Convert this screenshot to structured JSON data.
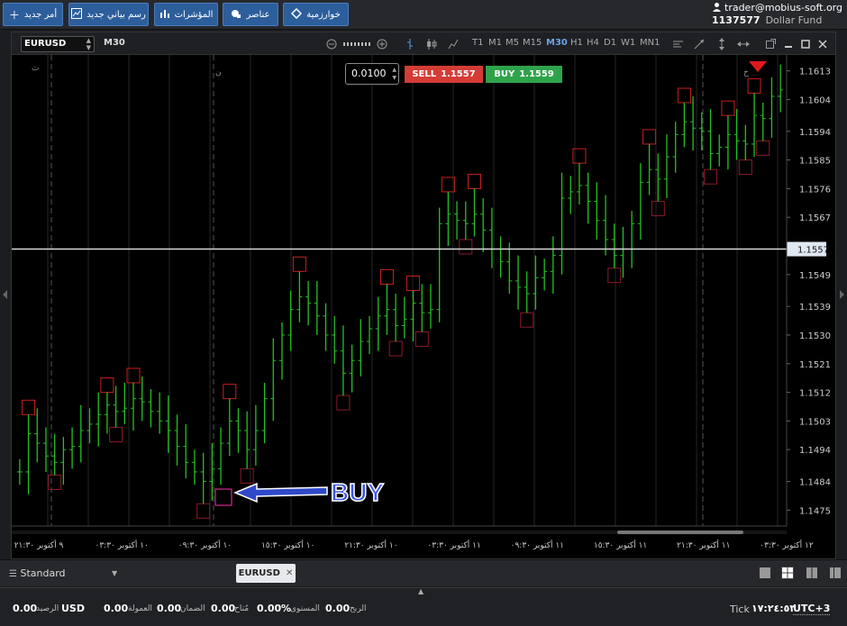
{
  "topbar": {
    "buttons": [
      {
        "label": "أمر جديد",
        "icon": "plus-icon"
      },
      {
        "label": "رسم بياني جديد",
        "icon": "chart-icon"
      },
      {
        "label": "المؤشرات",
        "icon": "bars-icon"
      },
      {
        "label": "عناصر",
        "icon": "shapes-icon"
      },
      {
        "label": "خوارزمية",
        "icon": "diamond-icon"
      }
    ],
    "account_email": "trader@mobius-soft.org",
    "account_number": "1137577",
    "account_fund": "Dollar Fund"
  },
  "chart_window": {
    "symbol": "EURUSD",
    "timeframe": "M30",
    "timeframes": [
      "T1",
      "M1",
      "M5",
      "M15",
      "M30",
      "H1",
      "H4",
      "D1",
      "W1",
      "MN1"
    ],
    "active_timeframe": "M30",
    "lot_value": "0.0100",
    "sell_label": "SELL",
    "sell_price": "1.1557",
    "buy_label": "BUY",
    "buy_price": "1.1559",
    "annotation": "BUY",
    "session_marks": [
      "ث",
      "ن",
      "خ"
    ]
  },
  "chart_data": {
    "type": "ohlc",
    "symbol": "EURUSD",
    "timeframe": "M30",
    "current_price": 1.1557,
    "ylim": [
      1.147,
      1.1618
    ],
    "y_ticks": [
      "1.1613",
      "1.1604",
      "1.1594",
      "1.1585",
      "1.1576",
      "1.1567",
      "1.1557",
      "1.1549",
      "1.1539",
      "1.1530",
      "1.1521",
      "1.1512",
      "1.1503",
      "1.1494",
      "1.1484",
      "1.1475"
    ],
    "x_ticks": [
      "٩ أكتوبر ٢١:٣٠",
      "١٠ أكتوبر ٠٣:٣٠",
      "١٠ أكتوبر ٠٩:٣٠",
      "١٠ أكتوبر ١٥:٣٠",
      "١٠ أكتوبر ٢١:٣٠",
      "١١ أكتوبر ٠٣:٣٠",
      "١١ أكتوبر ٠٩:٣٠",
      "١١ أكتوبر ١٥:٣٠",
      "١١ أكتوبر ٢١:٣٠",
      "١٢ أكتوبر ٠٣:٣٠"
    ],
    "closes": [
      1.1487,
      1.1499,
      1.1496,
      1.1492,
      1.149,
      1.1494,
      1.1495,
      1.15,
      1.1502,
      1.1505,
      1.1508,
      1.1506,
      1.1507,
      1.151,
      1.1509,
      1.1506,
      1.1503,
      1.15,
      1.1495,
      1.149,
      1.1487,
      1.1484,
      1.1488,
      1.1496,
      1.1503,
      1.15,
      1.1494,
      1.15,
      1.151,
      1.1522,
      1.153,
      1.1538,
      1.1542,
      1.154,
      1.1536,
      1.153,
      1.1525,
      1.1518,
      1.1522,
      1.1528,
      1.1532,
      1.1536,
      1.1538,
      1.1533,
      1.1535,
      1.154,
      1.1537,
      1.1538,
      1.1565,
      1.1568,
      1.1566,
      1.1565,
      1.1568,
      1.1563,
      1.1557,
      1.1553,
      1.1547,
      1.1545,
      1.1543,
      1.1548,
      1.155,
      1.1555,
      1.1573,
      1.1575,
      1.1577,
      1.1572,
      1.1566,
      1.156,
      1.1555,
      1.1557,
      1.1565,
      1.1578,
      1.1582,
      1.1579,
      1.1586,
      1.1593,
      1.1597,
      1.1595,
      1.1594,
      1.1587,
      1.1589,
      1.1593,
      1.1591,
      1.159,
      1.1599,
      1.1598,
      1.1605,
      1.1607
    ]
  },
  "bottom_tabs": {
    "layout_label": "Standard",
    "open_tab": "EURUSD",
    "layout_icons": [
      "layout-single-icon",
      "layout-quad-icon",
      "layout-columns-icon",
      "layout-rows-icon"
    ]
  },
  "status": {
    "currency": "USD",
    "balance_label": "الرصيد",
    "balance_value": "0.00",
    "commission_label": "العمولة",
    "commission_value": "0.00",
    "margin_label": "الضمان",
    "margin_value": "0.00",
    "free_label": "مُتاح",
    "free_value": "0.00",
    "level_label": "المستوى",
    "level_value": "%",
    "profit_label": "الربح",
    "profit_value": "0.00",
    "tick_label": "Tick",
    "time": "١٧:٢٤:٥٣",
    "timezone": "UTC+3"
  }
}
